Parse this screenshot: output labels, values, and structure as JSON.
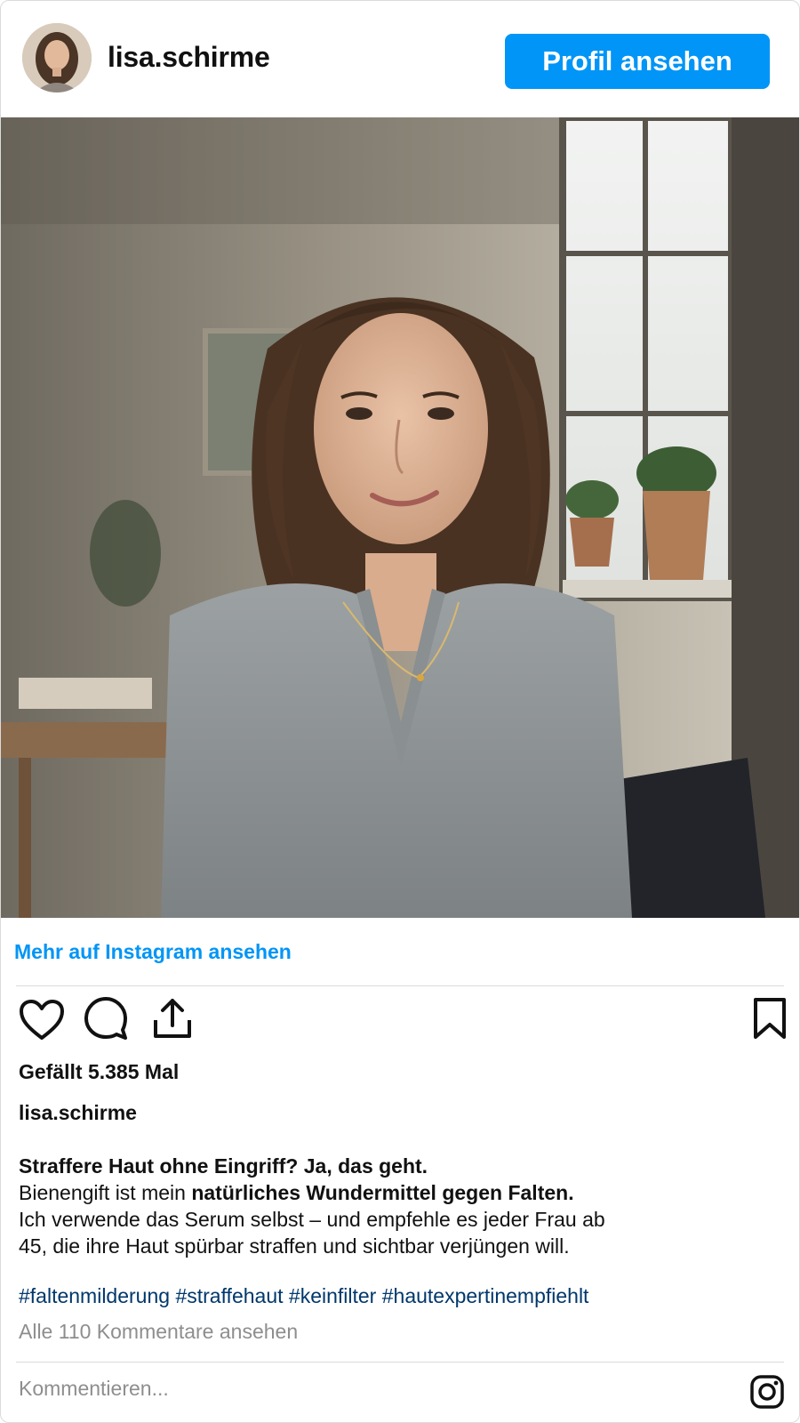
{
  "header": {
    "username": "lisa.schirme",
    "profile_button_label": "Profil ansehen"
  },
  "photo": {
    "alt": "Porträtfoto einer Frau im grauen Pullover"
  },
  "links": {
    "more_on_instagram": "Mehr auf Instagram ansehen"
  },
  "actions": {
    "icons": [
      "heart-icon",
      "comment-icon",
      "share-icon",
      "bookmark-icon"
    ]
  },
  "post": {
    "likes": "Gefällt 5.385 Mal",
    "caption_username": "lisa.schirme",
    "caption": {
      "line1_bold": "Straffere Haut ohne Eingriff? Ja, das geht.",
      "line2_prefix": "Bienengift ist mein ",
      "line2_bold": "natürliches Wundermittel gegen Falten.",
      "line3": "Ich verwende das Serum selbst – und empfehle es jeder Frau ab",
      "line4": "45, die ihre Haut spürbar straffen und sichtbar verjüngen will."
    },
    "hashtags": [
      "#faltenmilderung",
      "#straffehaut",
      "#keinfilter",
      "#hautexpertinempfiehlt"
    ],
    "view_comments": "Alle 110 Kommentare ansehen"
  },
  "comment": {
    "placeholder": "Kommentieren..."
  },
  "colors": {
    "accent": "#0095f6",
    "hashtag": "#00376b",
    "muted": "#8e8e8e",
    "border": "#dbdbdb"
  }
}
